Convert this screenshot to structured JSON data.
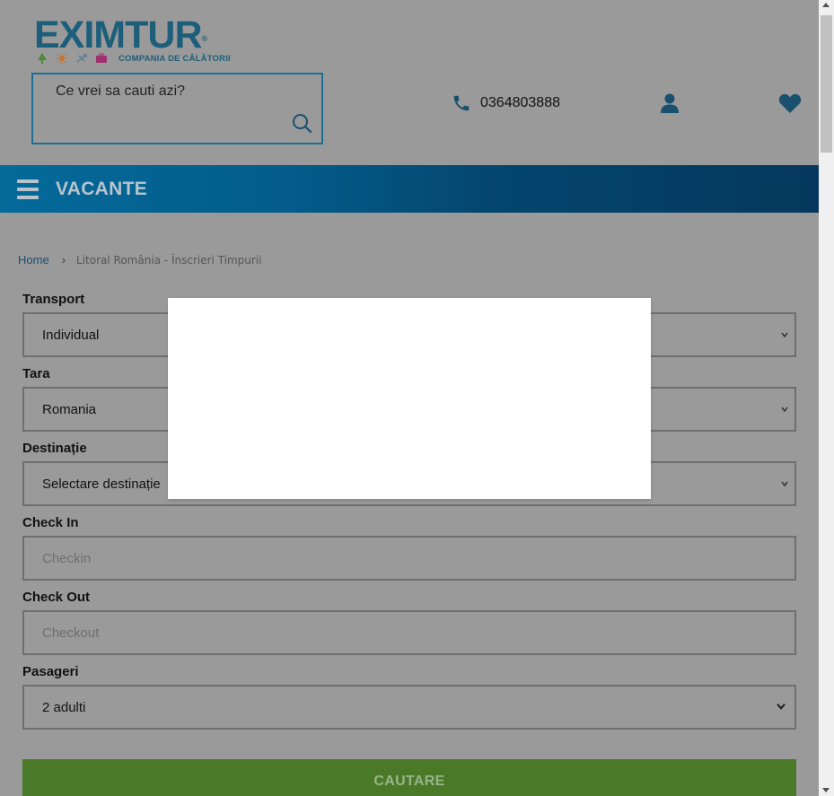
{
  "header": {
    "logo_text": "EXIMTUR",
    "logo_reg": "®",
    "logo_tagline": "COMPANIA DE CĂLĂTORII",
    "search_placeholder": "Ce vrei sa cauti azi?",
    "phone": "0364803888",
    "icons": [
      "phone-icon",
      "user-icon",
      "heart-icon",
      "search-icon"
    ]
  },
  "nav": {
    "menu_label": "VACANTE"
  },
  "breadcrumb": {
    "home": "Home",
    "separator": "›",
    "current": "Litoral România - Înscrieri Timpurii"
  },
  "form": {
    "transport": {
      "label": "Transport",
      "value": "Individual"
    },
    "tara": {
      "label": "Tara",
      "value": "Romania"
    },
    "destinatie": {
      "label": "Destinație",
      "value": "Selectare destinație"
    },
    "checkin": {
      "label": "Check In",
      "placeholder": "Checkin"
    },
    "checkout": {
      "label": "Check Out",
      "placeholder": "Checkout"
    },
    "pasageri": {
      "label": "Pasageri",
      "value": "2 adulti"
    },
    "submit_label": "CAUTARE"
  },
  "colors": {
    "brand_blue": "#1d5f7a",
    "nav_gradient_start": "#046a9a",
    "nav_gradient_end": "#05385c",
    "submit_green": "#4a7a28",
    "overlay_bg": "#9a9a9a"
  }
}
